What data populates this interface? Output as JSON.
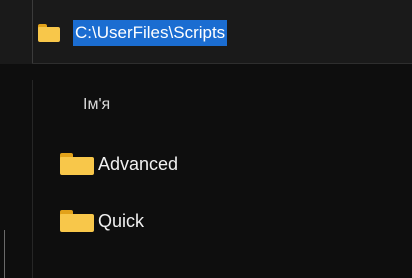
{
  "address_bar": {
    "icon": "folder-icon",
    "path": "C:\\UserFiles\\Scripts"
  },
  "file_list": {
    "column_header": "Ім'я",
    "items": [
      {
        "label": "Advanced",
        "icon": "folder-icon"
      },
      {
        "label": "Quick",
        "icon": "folder-icon"
      }
    ]
  },
  "colors": {
    "selection": "#1b6dd1",
    "folder": "#f8c74a",
    "background": "#0e0e0e"
  }
}
